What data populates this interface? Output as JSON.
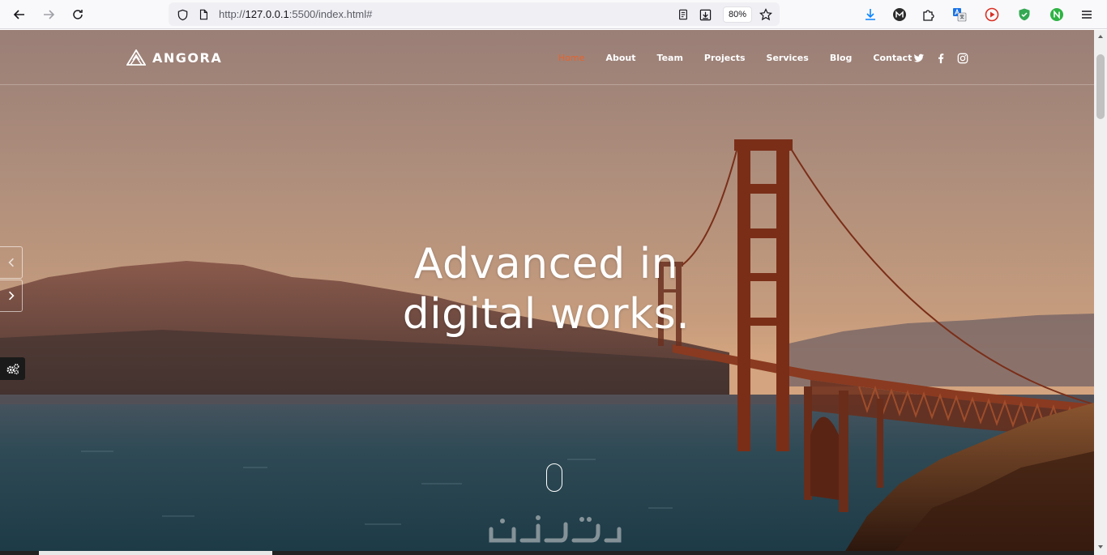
{
  "browser": {
    "url_prefix": "http://",
    "url_host": "127.0.0.1",
    "url_rest": ":5500/index.html#",
    "zoom": "80%"
  },
  "header": {
    "logo_text": "ANGORA",
    "nav": [
      {
        "label": "Home",
        "active": true
      },
      {
        "label": "About"
      },
      {
        "label": "Team"
      },
      {
        "label": "Projects"
      },
      {
        "label": "Services"
      },
      {
        "label": "Blog"
      },
      {
        "label": "Contact"
      }
    ],
    "social": [
      "twitter-icon",
      "facebook-icon",
      "instagram-icon"
    ]
  },
  "hero": {
    "title_line1": "Advanced in",
    "title_line2": "digital works."
  },
  "colors": {
    "accent": "#e8622b",
    "chrome_bg": "#f9f9fb",
    "urlbar_bg": "#f0f0f4"
  }
}
